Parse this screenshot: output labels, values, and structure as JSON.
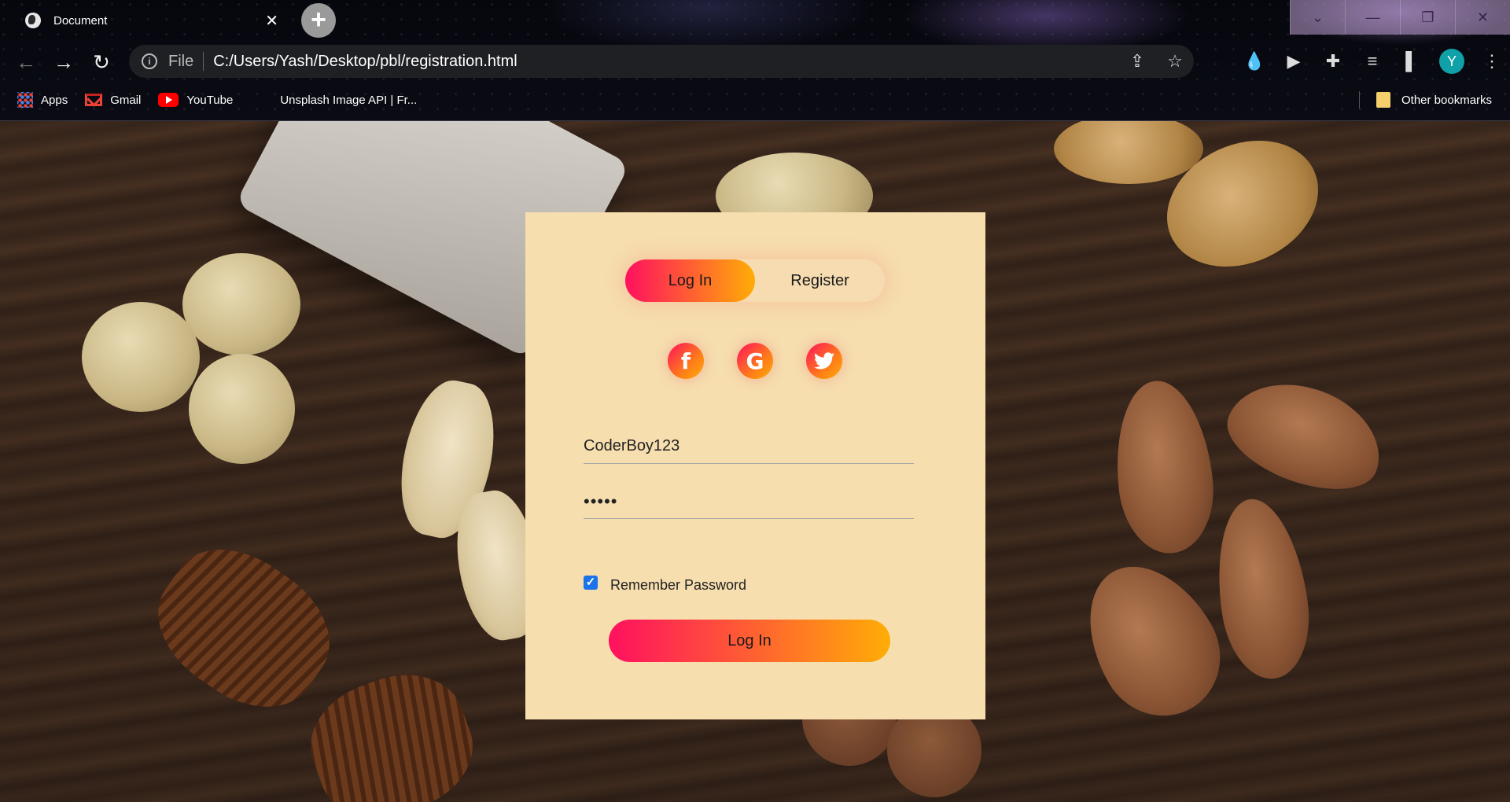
{
  "browser": {
    "tab_title": "Document",
    "tab_close": "✕",
    "new_tab": "+",
    "address": {
      "scheme_label": "File",
      "url": "C:/Users/Yash/Desktop/pbl/registration.html"
    },
    "profile_initial": "Y",
    "bookmarks": [
      {
        "label": "Apps",
        "icon": "apps-grid-icon"
      },
      {
        "label": "Gmail",
        "icon": "gmail-icon"
      },
      {
        "label": "YouTube",
        "icon": "youtube-icon"
      },
      {
        "label": "Unsplash Image API | Fr...",
        "icon": ""
      }
    ],
    "other_bookmarks": "Other bookmarks"
  },
  "form": {
    "tabs": {
      "login": "Log In",
      "register": "Register"
    },
    "socials": [
      {
        "name": "facebook",
        "glyph": "f"
      },
      {
        "name": "google",
        "glyph": "G"
      },
      {
        "name": "twitter",
        "glyph": "t"
      }
    ],
    "username_value": "CoderBoy123",
    "password_value": "•••••",
    "remember_label": "Remember Password",
    "remember_checked": true,
    "submit_label": "Log In"
  },
  "colors": {
    "card_bg": "#f6deaf",
    "gradient_start": "#ff105f",
    "gradient_end": "#ffad06",
    "checkbox": "#1a73e8"
  }
}
